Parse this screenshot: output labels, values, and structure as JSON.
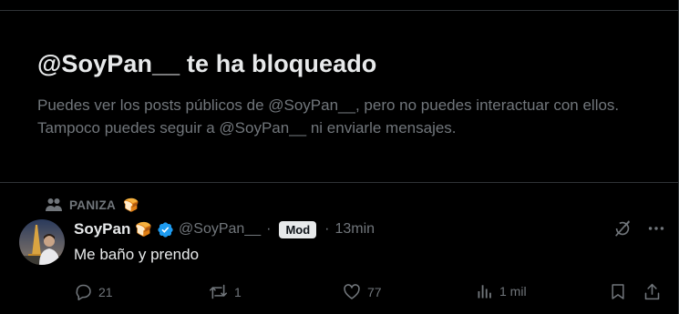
{
  "block_notice": {
    "title": "@SoyPan__ te ha bloqueado",
    "description": "Puedes ver los posts públicos de @SoyPan__, pero no puedes interactuar con ellos. Tampoco puedes seguir a @SoyPan__ ni enviarle mensajes."
  },
  "post": {
    "community_label": "PANIZA",
    "community_emoji": "🍞",
    "author_name": "SoyPan",
    "author_emoji": "🍞",
    "handle": "@SoyPan__",
    "separator": "·",
    "mod_label": "Mod",
    "time": "13min",
    "text": "Me baño y prendo",
    "stats": {
      "replies": "21",
      "reposts": "1",
      "likes": "77",
      "views": "1 mil"
    }
  },
  "icons": [
    "community-icon",
    "verified-badge-icon",
    "grok-icon",
    "more-icon",
    "reply-icon",
    "repost-icon",
    "like-icon",
    "views-icon",
    "bookmark-icon",
    "share-icon"
  ],
  "colors": {
    "background": "#000000",
    "text": "#e7e9ea",
    "secondary": "#71767b",
    "verified": "#1d9bf0",
    "border": "#2f3336"
  }
}
